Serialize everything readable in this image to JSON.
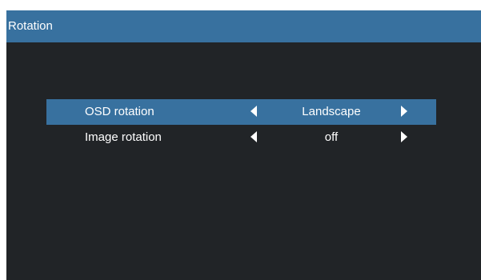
{
  "window": {
    "title": "Rotation"
  },
  "menu": {
    "items": [
      {
        "label": "OSD rotation",
        "value": "Landscape",
        "selected": true,
        "left_icon": "caret-left-icon",
        "right_icon": "caret-right-icon"
      },
      {
        "label": "Image rotation",
        "value": "off",
        "selected": false,
        "left_icon": "caret-left-icon",
        "right_icon": "caret-right-icon"
      }
    ]
  },
  "colors": {
    "accent": "#38719f",
    "background": "#212427",
    "text": "#ffffff"
  }
}
